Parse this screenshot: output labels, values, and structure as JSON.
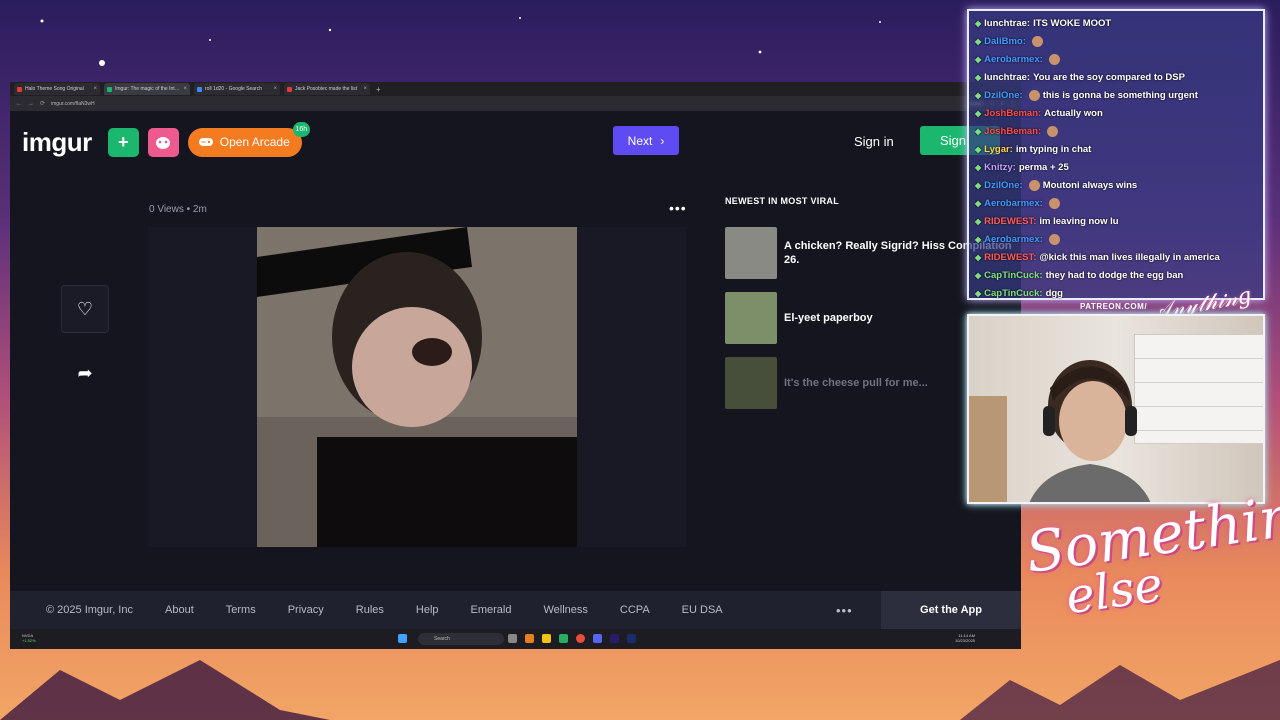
{
  "browser": {
    "tabs": [
      {
        "title": "Halo Theme Song Original",
        "color": "#e53935",
        "active": false
      },
      {
        "title": "Imgur: The magic of the Internet",
        "color": "#1bb76e",
        "active": true
      },
      {
        "title": "roll 1d20 - Google Search",
        "color": "#4285f4",
        "active": false
      },
      {
        "title": "Jack Posobiec made the list",
        "color": "#e53935",
        "active": false
      }
    ],
    "url": "imgur.com/fIaN3wH",
    "zoom": "210%"
  },
  "imgur": {
    "logo": "imgur",
    "arcade_label": "Open Arcade",
    "arcade_badge": "16h",
    "next_label": "Next",
    "signin_label": "Sign in",
    "signup_label": "Sign",
    "post_meta": "0 Views • 2m",
    "newest_title": "NEWEST IN MOST VIRAL",
    "viral": [
      {
        "title": "A chicken? Really Sigrid? Hiss Compilation 26.",
        "thumb_color": "#8a8a84",
        "dim": false
      },
      {
        "title": "El-yeet paperboy",
        "thumb_color": "#7d8f68",
        "dim": false
      },
      {
        "title": "It's the cheese pull for me...",
        "thumb_color": "#7a8a55",
        "dim": true
      }
    ],
    "footer": {
      "links": [
        "© 2025 Imgur, Inc",
        "About",
        "Terms",
        "Privacy",
        "Rules",
        "Help",
        "Emerald",
        "Wellness",
        "CCPA",
        "EU DSA"
      ],
      "more": "•••",
      "get_app": "Get the App"
    }
  },
  "taskbar": {
    "stock_name": "NVDA",
    "stock_change": "+1.52%",
    "search_placeholder": "Search",
    "time": "11:14 AM",
    "date": "10/23/2025"
  },
  "chat": [
    {
      "user": "lunchtrae:",
      "user_color": "#ffffff",
      "msg": "ITS WOKE MOOT",
      "emote": false
    },
    {
      "user": "DaliBmo:",
      "user_color": "#3d9bff",
      "msg": "",
      "emote": true
    },
    {
      "user": "Aerobarmex:",
      "user_color": "#3d9bff",
      "msg": "",
      "emote": true
    },
    {
      "user": "lunchtrae:",
      "user_color": "#ffffff",
      "msg": "You are the soy compared to DSP",
      "emote": false
    },
    {
      "user": "DzilOne:",
      "user_color": "#3d9bff",
      "msg": "this is gonna be something urgent",
      "emote": true
    },
    {
      "user": "JoshBeman:",
      "user_color": "#ff4a4a",
      "msg": "Actually won",
      "emote": false
    },
    {
      "user": "JoshBeman:",
      "user_color": "#ff4a4a",
      "msg": "",
      "emote": true
    },
    {
      "user": "Lygar:",
      "user_color": "#ffd24a",
      "msg": "im typing in chat",
      "emote": false
    },
    {
      "user": "Knitzy:",
      "user_color": "#c59cff",
      "msg": "perma + 25",
      "emote": false
    },
    {
      "user": "DzilOne:",
      "user_color": "#3d9bff",
      "msg": "Moutoni always wins",
      "emote": true
    },
    {
      "user": "Aerobarmex:",
      "user_color": "#3d9bff",
      "msg": "",
      "emote": true
    },
    {
      "user": "RIDEWEST:",
      "user_color": "#ff5a5a",
      "msg": "im leaving now lu",
      "emote": false
    },
    {
      "user": "Aerobarmex:",
      "user_color": "#3d9bff",
      "msg": "",
      "emote": true
    },
    {
      "user": "RIDEWEST:",
      "user_color": "#ff5a5a",
      "msg": "@kick this man lives illegally in america",
      "emote": false
    },
    {
      "user": "CapTinCuck:",
      "user_color": "#7ee07e",
      "msg": "they had to dodge the egg ban",
      "emote": false
    },
    {
      "user": "CapTinCuck:",
      "user_color": "#7ee07e",
      "msg": "dgg",
      "emote": false
    }
  ],
  "overlay": {
    "patreon": "PATREON.COM/",
    "signature": "Anything Else",
    "logo_line1": "Something",
    "logo_line2": "else"
  }
}
